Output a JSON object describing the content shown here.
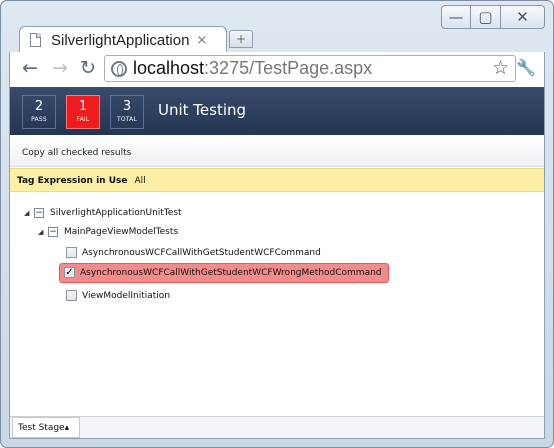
{
  "browser": {
    "tab_title": "SilverlightApplication",
    "tab_close": "×",
    "new_tab": "+",
    "url_host": "localhost",
    "url_rest": ":3275/TestPage.aspx",
    "window_controls": {
      "minimize": "—",
      "maximize": "▢",
      "close": "✕"
    },
    "nav": {
      "back": "←",
      "forward": "→",
      "reload": "↻"
    },
    "star": "☆",
    "wrench": "🔧"
  },
  "summary": {
    "title": "Unit Testing",
    "stats": [
      {
        "count": "2",
        "label": "PASS"
      },
      {
        "count": "1",
        "label": "FAIL"
      },
      {
        "count": "3",
        "label": "TOTAL"
      }
    ],
    "colors": {
      "banner": "#2a3b5b",
      "fail": "#ee1c1c"
    }
  },
  "actions": {
    "copy_results": "Copy all checked results"
  },
  "tag_expression": {
    "label": "Tag Expression in Use",
    "value": "All"
  },
  "tree": {
    "root": {
      "label": "SilverlightApplicationUnitTest",
      "collapse": "−",
      "expander": "◢"
    },
    "group": {
      "label": "MainPageViewModelTests",
      "collapse": "−",
      "expander": "◢"
    },
    "tests": [
      {
        "label": "AsynchronousWCFCallWithGetStudentWCFCommand",
        "checked": false,
        "failed": false
      },
      {
        "label": "AsynchronousWCFCallWithGetStudentWCFWrongMethodCommand",
        "checked": true,
        "failed": true,
        "check": "✓"
      },
      {
        "label": "ViewModelInitiation",
        "checked": false,
        "failed": false
      }
    ],
    "colors": {
      "failed_highlight": "#f28c8c"
    }
  },
  "footer": {
    "stage_tab": "Test Stage▴"
  }
}
